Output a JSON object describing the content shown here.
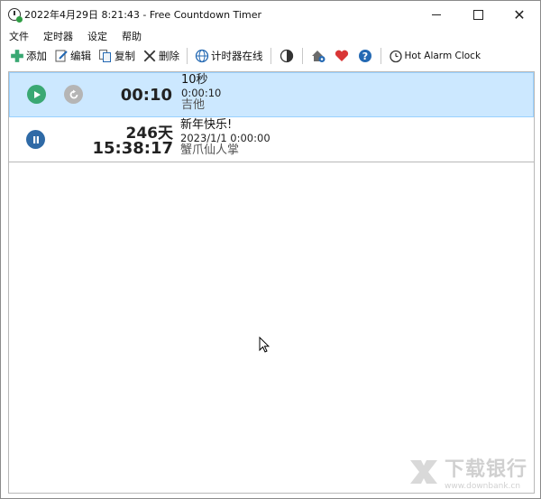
{
  "window": {
    "title": "2022年4月29日 8:21:43 - Free Countdown Timer",
    "controls": {
      "minimize": "",
      "maximize": "",
      "close": "✕"
    }
  },
  "menu": [
    "文件",
    "定时器",
    "设定",
    "帮助"
  ],
  "toolbar": {
    "add": "添加",
    "edit": "编辑",
    "copy": "复制",
    "delete": "删除",
    "online": "计时器在线",
    "hot_alarm": "Hot Alarm Clock"
  },
  "timers": [
    {
      "remaining": "00:10",
      "name": "10秒",
      "target": "0:00:10",
      "sound": "吉他",
      "state": "stopped"
    },
    {
      "days": "246天",
      "remaining": "15:38:17",
      "name": "新年快乐!",
      "target": "2023/1/1 0:00:00",
      "sound": "蟹爪仙人掌",
      "state": "running"
    }
  ],
  "watermark": {
    "title": "下载银行",
    "url": "www.downbank.cn"
  },
  "colors": {
    "play": "#3aa873",
    "pause": "#2f6aa6",
    "reset": "#b5b5b5",
    "selection": "#cce8ff",
    "heart": "#d93636",
    "help": "#2469b3"
  }
}
